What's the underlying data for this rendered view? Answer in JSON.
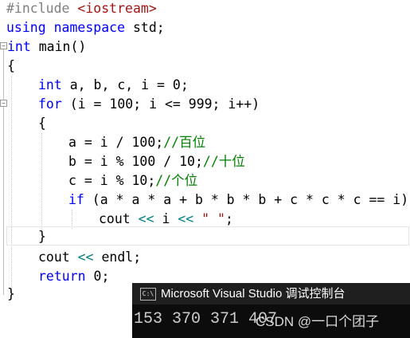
{
  "code": {
    "include_directive": "#include",
    "include_header": "<iostream>",
    "kw_using": "using",
    "kw_namespace": "namespace",
    "std_text": " std;",
    "kw_int": "int",
    "main_sig": " main()",
    "brace_open": "{",
    "decl_rest": " a, b, c, i = 0;",
    "kw_for": "for",
    "for_rest": " (i = 100; i <= 999; i++)",
    "inner_brace_open": "{",
    "line_a_code": "a = i / 100;",
    "line_a_comment": "//百位",
    "line_b_code": "b = i % 100 / 10;",
    "line_b_comment": "//十位",
    "line_c_code": "c = i % 10;",
    "line_c_comment": "//个位",
    "kw_if": "if",
    "if_rest": " (a * a * a + b * b * b + c * c * c == i)",
    "cout_text": "cout ",
    "op_shift": "<<",
    "cout_mid": " i ",
    "cout_string": "\" \"",
    "cout_end": ";",
    "inner_brace_close": "}",
    "endl_cout": "cout ",
    "endl_text": " endl;",
    "kw_return": "return",
    "return_rest": " 0;",
    "brace_close": "}"
  },
  "console": {
    "title": "Microsoft Visual Studio 调试控制台",
    "icon_text": "C:\\",
    "output": "153 370 371 407"
  },
  "watermark": "CSDN @一口‍个团子",
  "colors": {
    "keyword": "#0000ff",
    "operator": "#008080",
    "string": "#a31515",
    "comment": "#008000",
    "console_bg": "#0c0c0c"
  }
}
